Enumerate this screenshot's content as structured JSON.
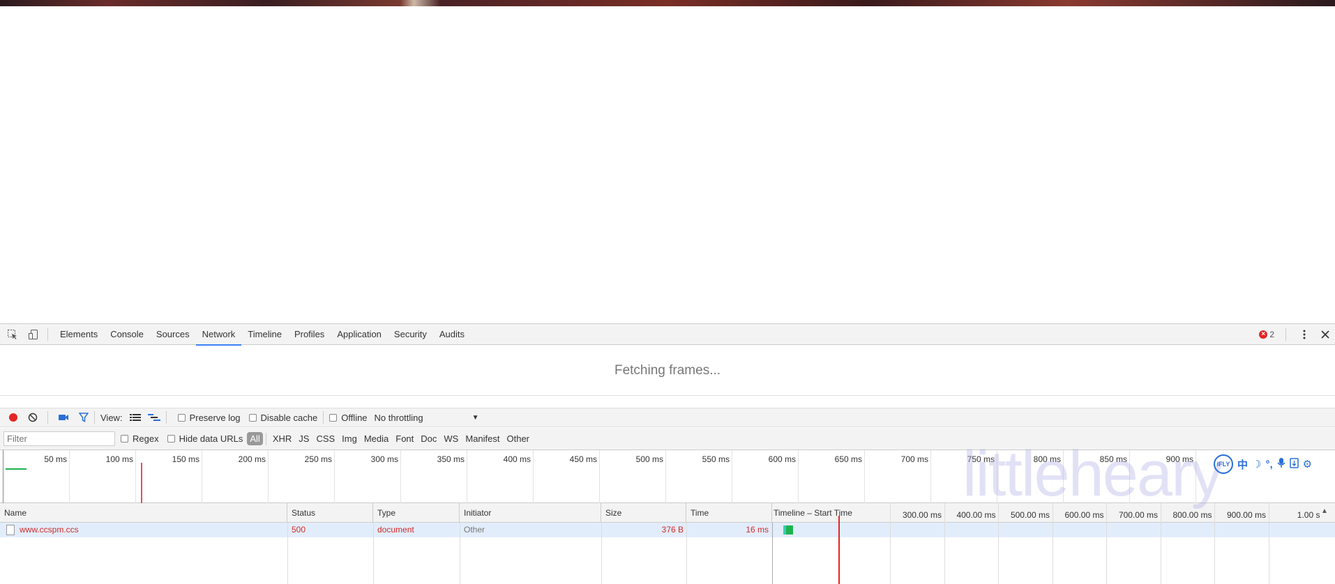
{
  "devtools": {
    "tabs": [
      "Elements",
      "Console",
      "Sources",
      "Network",
      "Timeline",
      "Profiles",
      "Application",
      "Security",
      "Audits"
    ],
    "active_tab": "Network",
    "error_count": "2"
  },
  "frames": {
    "message": "Fetching frames..."
  },
  "toolbar": {
    "view_label": "View:",
    "preserve_log": "Preserve log",
    "disable_cache": "Disable cache",
    "offline": "Offline",
    "throttling": "No throttling"
  },
  "filterbar": {
    "placeholder": "Filter",
    "regex": "Regex",
    "hide_data_urls": "Hide data URLs",
    "types": [
      "All",
      "XHR",
      "JS",
      "CSS",
      "Img",
      "Media",
      "Font",
      "Doc",
      "WS",
      "Manifest",
      "Other"
    ],
    "selected_type": "All"
  },
  "overview": {
    "ticks": [
      "50 ms",
      "100 ms",
      "150 ms",
      "200 ms",
      "250 ms",
      "300 ms",
      "350 ms",
      "400 ms",
      "450 ms",
      "500 ms",
      "550 ms",
      "600 ms",
      "650 ms",
      "700 ms",
      "750 ms",
      "800 ms",
      "850 ms",
      "900 ms"
    ]
  },
  "table": {
    "headers": [
      "Name",
      "Status",
      "Type",
      "Initiator",
      "Size",
      "Time",
      "Timeline – Start Time"
    ],
    "waterfall_ticks": [
      "300.00 ms",
      "400.00 ms",
      "500.00 ms",
      "600.00 ms",
      "700.00 ms",
      "800.00 ms",
      "900.00 ms",
      "1.00 s"
    ],
    "rows": [
      {
        "name": "www.ccspm.ccs",
        "status": "500",
        "type": "document",
        "initiator": "Other",
        "size": "376 B",
        "time": "16 ms"
      }
    ]
  },
  "watermark": {
    "text": "littleheary"
  },
  "ifly": {
    "logo": "iFLY",
    "lang": "中"
  },
  "colors": {
    "accent": "#3e82f7",
    "error": "#d32a2a",
    "row_selected": "#e2edfb",
    "record": "#e42525"
  }
}
